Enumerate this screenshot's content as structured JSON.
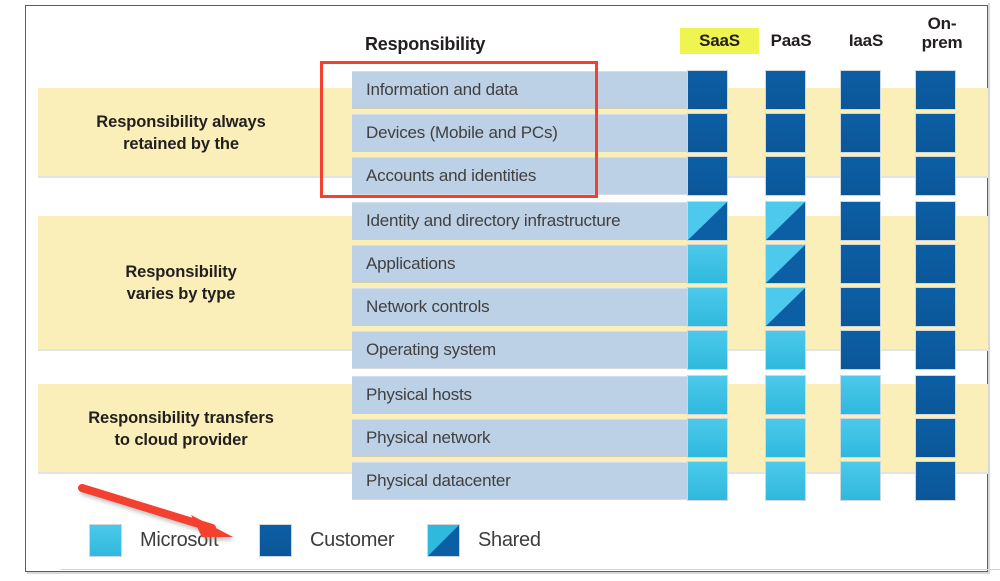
{
  "diagram": {
    "title_column_header": "Responsibility",
    "provider_columns": [
      {
        "id": "saas",
        "label": "SaaS",
        "highlighted": true,
        "highlight_color": "#eef551"
      },
      {
        "id": "paas",
        "label": "PaaS",
        "highlighted": false
      },
      {
        "id": "iaas",
        "label": "IaaS",
        "highlighted": false
      },
      {
        "id": "onprem",
        "label": "On-\nprem",
        "label_line1": "On-",
        "label_line2": "prem",
        "highlighted": false
      }
    ],
    "groups": [
      {
        "id": "always-retained",
        "label_line1": "Responsibility always",
        "label_line2": "retained by the",
        "row_count": 3
      },
      {
        "id": "varies-by-type",
        "label_line1": "Responsibility",
        "label_line2": "varies by type",
        "row_count": 4
      },
      {
        "id": "transfers-to-provider",
        "label_line1": "Responsibility transfers",
        "label_line2": "to cloud provider",
        "row_count": 3
      }
    ],
    "rows": [
      {
        "id": "information-and-data",
        "label": "Information and data",
        "group": "always-retained",
        "saas": "customer",
        "paas": "customer",
        "iaas": "customer",
        "onprem": "customer"
      },
      {
        "id": "devices-mobile-and-pcs",
        "label": "Devices (Mobile and PCs)",
        "group": "always-retained",
        "saas": "customer",
        "paas": "customer",
        "iaas": "customer",
        "onprem": "customer"
      },
      {
        "id": "accounts-and-identities",
        "label": "Accounts and identities",
        "group": "always-retained",
        "saas": "customer",
        "paas": "customer",
        "iaas": "customer",
        "onprem": "customer"
      },
      {
        "id": "identity-and-directory-infrastructure",
        "label": "Identity and directory infrastructure",
        "group": "varies-by-type",
        "saas": "shared",
        "paas": "shared",
        "iaas": "customer",
        "onprem": "customer"
      },
      {
        "id": "applications",
        "label": "Applications",
        "group": "varies-by-type",
        "saas": "microsoft",
        "paas": "shared",
        "iaas": "customer",
        "onprem": "customer"
      },
      {
        "id": "network-controls",
        "label": "Network controls",
        "group": "varies-by-type",
        "saas": "microsoft",
        "paas": "shared",
        "iaas": "customer",
        "onprem": "customer"
      },
      {
        "id": "operating-system",
        "label": "Operating system",
        "group": "varies-by-type",
        "saas": "microsoft",
        "paas": "microsoft",
        "iaas": "customer",
        "onprem": "customer"
      },
      {
        "id": "physical-hosts",
        "label": "Physical hosts",
        "group": "transfers-to-provider",
        "saas": "microsoft",
        "paas": "microsoft",
        "iaas": "microsoft",
        "onprem": "customer"
      },
      {
        "id": "physical-network",
        "label": "Physical network",
        "group": "transfers-to-provider",
        "saas": "microsoft",
        "paas": "microsoft",
        "iaas": "microsoft",
        "onprem": "customer"
      },
      {
        "id": "physical-datacenter",
        "label": "Physical datacenter",
        "group": "transfers-to-provider",
        "saas": "microsoft",
        "paas": "microsoft",
        "iaas": "microsoft",
        "onprem": "customer"
      }
    ],
    "legend": [
      {
        "id": "microsoft",
        "label": "Microsoft",
        "swatch": "microsoft",
        "color": "#4cc9ec"
      },
      {
        "id": "customer",
        "label": "Customer",
        "swatch": "customer",
        "color": "#0c5fa5"
      },
      {
        "id": "shared",
        "label": "Shared",
        "swatch": "shared",
        "color": "#0c5fa5"
      }
    ],
    "annotations": [
      {
        "id": "highlight-rectangle",
        "type": "rectangle",
        "color": "#f4402e",
        "targets": "Information and data / Devices (Mobile and PCs) / Accounts and identities"
      },
      {
        "id": "pointer-arrow",
        "type": "arrow",
        "color": "#f4402e",
        "points_to": "Customer"
      }
    ],
    "colors": {
      "band": "#faeeb9",
      "row": "#bcd0e6",
      "customer": "#0c5fa5",
      "microsoft": "#4cc9ec",
      "annotation": "#f4402e",
      "highlight": "#eef551"
    }
  }
}
